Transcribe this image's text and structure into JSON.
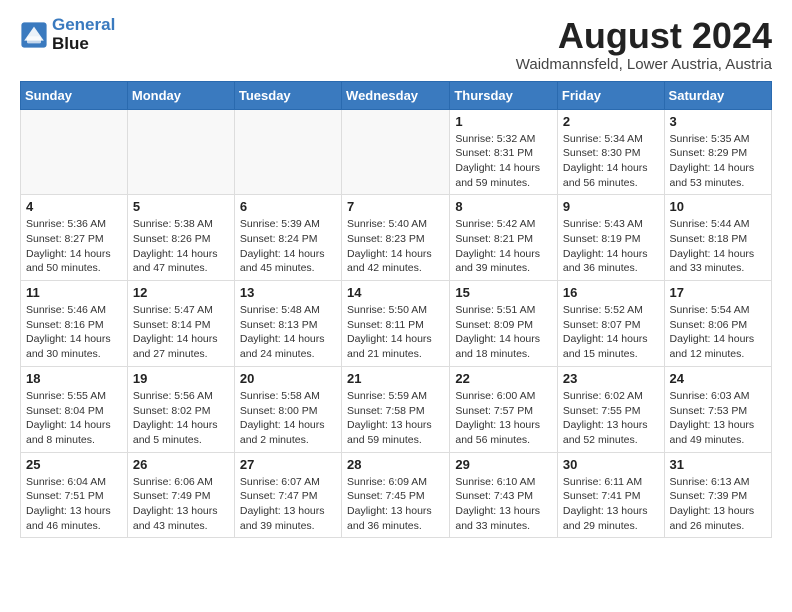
{
  "logo": {
    "line1": "General",
    "line2": "Blue"
  },
  "title": "August 2024",
  "subtitle": "Waidmannsfeld, Lower Austria, Austria",
  "days_of_week": [
    "Sunday",
    "Monday",
    "Tuesday",
    "Wednesday",
    "Thursday",
    "Friday",
    "Saturday"
  ],
  "weeks": [
    [
      {
        "day": "",
        "info": ""
      },
      {
        "day": "",
        "info": ""
      },
      {
        "day": "",
        "info": ""
      },
      {
        "day": "",
        "info": ""
      },
      {
        "day": "1",
        "info": "Sunrise: 5:32 AM\nSunset: 8:31 PM\nDaylight: 14 hours\nand 59 minutes."
      },
      {
        "day": "2",
        "info": "Sunrise: 5:34 AM\nSunset: 8:30 PM\nDaylight: 14 hours\nand 56 minutes."
      },
      {
        "day": "3",
        "info": "Sunrise: 5:35 AM\nSunset: 8:29 PM\nDaylight: 14 hours\nand 53 minutes."
      }
    ],
    [
      {
        "day": "4",
        "info": "Sunrise: 5:36 AM\nSunset: 8:27 PM\nDaylight: 14 hours\nand 50 minutes."
      },
      {
        "day": "5",
        "info": "Sunrise: 5:38 AM\nSunset: 8:26 PM\nDaylight: 14 hours\nand 47 minutes."
      },
      {
        "day": "6",
        "info": "Sunrise: 5:39 AM\nSunset: 8:24 PM\nDaylight: 14 hours\nand 45 minutes."
      },
      {
        "day": "7",
        "info": "Sunrise: 5:40 AM\nSunset: 8:23 PM\nDaylight: 14 hours\nand 42 minutes."
      },
      {
        "day": "8",
        "info": "Sunrise: 5:42 AM\nSunset: 8:21 PM\nDaylight: 14 hours\nand 39 minutes."
      },
      {
        "day": "9",
        "info": "Sunrise: 5:43 AM\nSunset: 8:19 PM\nDaylight: 14 hours\nand 36 minutes."
      },
      {
        "day": "10",
        "info": "Sunrise: 5:44 AM\nSunset: 8:18 PM\nDaylight: 14 hours\nand 33 minutes."
      }
    ],
    [
      {
        "day": "11",
        "info": "Sunrise: 5:46 AM\nSunset: 8:16 PM\nDaylight: 14 hours\nand 30 minutes."
      },
      {
        "day": "12",
        "info": "Sunrise: 5:47 AM\nSunset: 8:14 PM\nDaylight: 14 hours\nand 27 minutes."
      },
      {
        "day": "13",
        "info": "Sunrise: 5:48 AM\nSunset: 8:13 PM\nDaylight: 14 hours\nand 24 minutes."
      },
      {
        "day": "14",
        "info": "Sunrise: 5:50 AM\nSunset: 8:11 PM\nDaylight: 14 hours\nand 21 minutes."
      },
      {
        "day": "15",
        "info": "Sunrise: 5:51 AM\nSunset: 8:09 PM\nDaylight: 14 hours\nand 18 minutes."
      },
      {
        "day": "16",
        "info": "Sunrise: 5:52 AM\nSunset: 8:07 PM\nDaylight: 14 hours\nand 15 minutes."
      },
      {
        "day": "17",
        "info": "Sunrise: 5:54 AM\nSunset: 8:06 PM\nDaylight: 14 hours\nand 12 minutes."
      }
    ],
    [
      {
        "day": "18",
        "info": "Sunrise: 5:55 AM\nSunset: 8:04 PM\nDaylight: 14 hours\nand 8 minutes."
      },
      {
        "day": "19",
        "info": "Sunrise: 5:56 AM\nSunset: 8:02 PM\nDaylight: 14 hours\nand 5 minutes."
      },
      {
        "day": "20",
        "info": "Sunrise: 5:58 AM\nSunset: 8:00 PM\nDaylight: 14 hours\nand 2 minutes."
      },
      {
        "day": "21",
        "info": "Sunrise: 5:59 AM\nSunset: 7:58 PM\nDaylight: 13 hours\nand 59 minutes."
      },
      {
        "day": "22",
        "info": "Sunrise: 6:00 AM\nSunset: 7:57 PM\nDaylight: 13 hours\nand 56 minutes."
      },
      {
        "day": "23",
        "info": "Sunrise: 6:02 AM\nSunset: 7:55 PM\nDaylight: 13 hours\nand 52 minutes."
      },
      {
        "day": "24",
        "info": "Sunrise: 6:03 AM\nSunset: 7:53 PM\nDaylight: 13 hours\nand 49 minutes."
      }
    ],
    [
      {
        "day": "25",
        "info": "Sunrise: 6:04 AM\nSunset: 7:51 PM\nDaylight: 13 hours\nand 46 minutes."
      },
      {
        "day": "26",
        "info": "Sunrise: 6:06 AM\nSunset: 7:49 PM\nDaylight: 13 hours\nand 43 minutes."
      },
      {
        "day": "27",
        "info": "Sunrise: 6:07 AM\nSunset: 7:47 PM\nDaylight: 13 hours\nand 39 minutes."
      },
      {
        "day": "28",
        "info": "Sunrise: 6:09 AM\nSunset: 7:45 PM\nDaylight: 13 hours\nand 36 minutes."
      },
      {
        "day": "29",
        "info": "Sunrise: 6:10 AM\nSunset: 7:43 PM\nDaylight: 13 hours\nand 33 minutes."
      },
      {
        "day": "30",
        "info": "Sunrise: 6:11 AM\nSunset: 7:41 PM\nDaylight: 13 hours\nand 29 minutes."
      },
      {
        "day": "31",
        "info": "Sunrise: 6:13 AM\nSunset: 7:39 PM\nDaylight: 13 hours\nand 26 minutes."
      }
    ]
  ]
}
